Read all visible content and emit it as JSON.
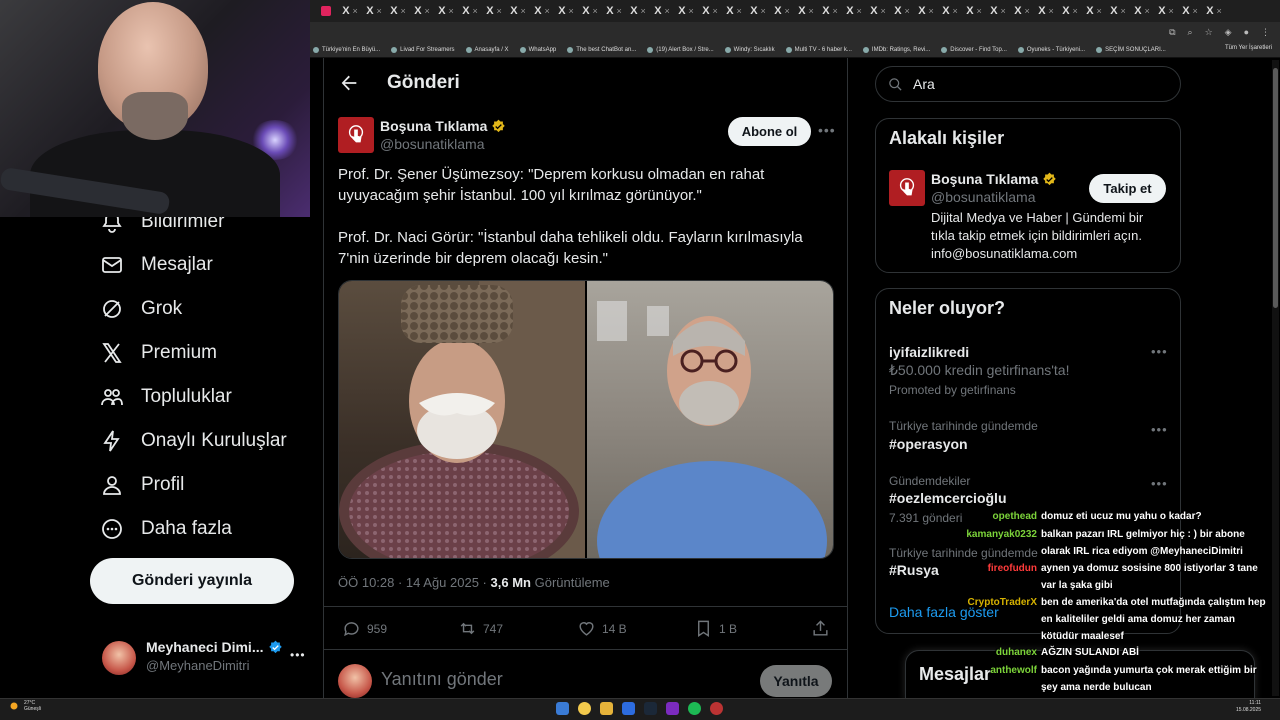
{
  "browser": {
    "tab_glyph": "X",
    "tab_close": "×",
    "bookmarks": [
      "Türkiye'nin En Büyü...",
      "Livad For Streamers",
      "Anasayfa / X",
      "WhatsApp",
      "The best ChatBot an...",
      "(19) Alert Box / Stre...",
      "Windy: Sıcaklık",
      "Multi TV - 6 haber k...",
      "IMDb: Ratings, Revi...",
      "Discover - Find Top...",
      "Oyuneks - Türkiyeni...",
      "SEÇİM SONUÇLARI..."
    ],
    "bookmarks_all": "Tüm Yer İşaretleri"
  },
  "nav": {
    "items": [
      {
        "label": "Bildirimler",
        "icon": "bell-icon"
      },
      {
        "label": "Mesajlar",
        "icon": "mail-icon"
      },
      {
        "label": "Grok",
        "icon": "grok-icon"
      },
      {
        "label": "Premium",
        "icon": "x-logo-icon"
      },
      {
        "label": "Topluluklar",
        "icon": "communities-icon"
      },
      {
        "label": "Onaylı Kuruluşlar",
        "icon": "lightning-icon"
      },
      {
        "label": "Profil",
        "icon": "person-icon"
      },
      {
        "label": "Daha fazla",
        "icon": "more-circle-icon"
      }
    ],
    "post_button": "Gönderi yayınla",
    "account": {
      "name": "Meyhaneci Dimi...",
      "handle": "@MeyhaneDimitri"
    }
  },
  "post": {
    "header_title": "Gönderi",
    "author": {
      "name": "Boşuna Tıklama",
      "handle": "@bosunatiklama"
    },
    "subscribe_button": "Abone ol",
    "paragraph1": "Prof. Dr. Şener Üşümezsoy: \"Deprem korkusu olmadan en rahat uyuyacağım şehir İstanbul. 100 yıl kırılmaz görünüyor.\"",
    "paragraph2": "Prof. Dr. Naci Görür: \"İstanbul daha tehlikeli oldu. Fayların kırılmasıyla 7'nin üzerinde bir deprem olacağı kesin.\"",
    "time": "ÖÖ 10:28 · 14 Ağu 2025 ·",
    "views_count": "3,6 Mn",
    "views_label": "Görüntüleme",
    "replies": "959",
    "reposts": "747",
    "likes": "14 B",
    "bookmarks": "1 B",
    "reply_placeholder": "Yanıtını gönder",
    "reply_button": "Yanıtla"
  },
  "sidebar": {
    "search_placeholder": "Ara",
    "related_title": "Alakalı kişiler",
    "related": {
      "name": "Boşuna Tıklama",
      "handle": "@bosunatiklama",
      "follow_button": "Takip et",
      "bio": "Dijital Medya ve Haber | Gündemi bir tıkla takip etmek için bildirimleri açın. info@bosunatiklama.com"
    },
    "trends_title": "Neler oluyor?",
    "trends": [
      {
        "name": "iyifaizlikredi",
        "sub": "₺50.000 kredin getirfinans'ta!",
        "ctx2": "Promoted by getirfinans"
      },
      {
        "ctx": "Türkiye tarihinde gündemde",
        "name": "#operasyon"
      },
      {
        "ctx": "Gündemdekiler",
        "name": "#oezlemcercioğlu",
        "sub": "7.391 gönderi"
      },
      {
        "ctx": "Türkiye tarihinde gündemde",
        "name": "#Rusya"
      }
    ],
    "more_link": "Daha fazla göster",
    "messages_title": "Mesajlar"
  },
  "chat": [
    {
      "user": "opethead",
      "color": "#7cd33a",
      "msg": "domuz eti ucuz mu yahu o kadar?"
    },
    {
      "user": "kamanyak0232",
      "color": "#7cd33a",
      "msg": "balkan pazarı IRL gelmiyor hiç : ) bir abone olarak IRL rica ediyom @MeyhaneciDimitri"
    },
    {
      "user": "fireofudun",
      "color": "#ff3b3b",
      "msg": "aynen ya domuz sosisine 800 istiyorlar 3 tane var la şaka gibi"
    },
    {
      "user": "CryptoTraderX",
      "color": "#d6b200",
      "msg": "ben de amerika'da otel mutfağında çalıştım hep en kaliteliler geldi ama domuz her zaman kötüdür maalesef"
    },
    {
      "user": "duhanex",
      "color": "#7cd33a",
      "msg": "AĞZIN SULANDI ABİ"
    },
    {
      "user": "anthewolf",
      "color": "#7cd33a",
      "msg": "bacon yağında yumurta çok merak ettiğim bir şey ama nerde bulucan"
    }
  ],
  "taskbar": {
    "temp": "27°C",
    "weather": "Güneşli",
    "time": "11:11",
    "date": "15.08.2025"
  },
  "colors": {
    "accent": "#1d9bf0",
    "verified_gold": "#e2b719",
    "verified_blue": "#1d9bf0",
    "brand_red": "#b01e22"
  }
}
